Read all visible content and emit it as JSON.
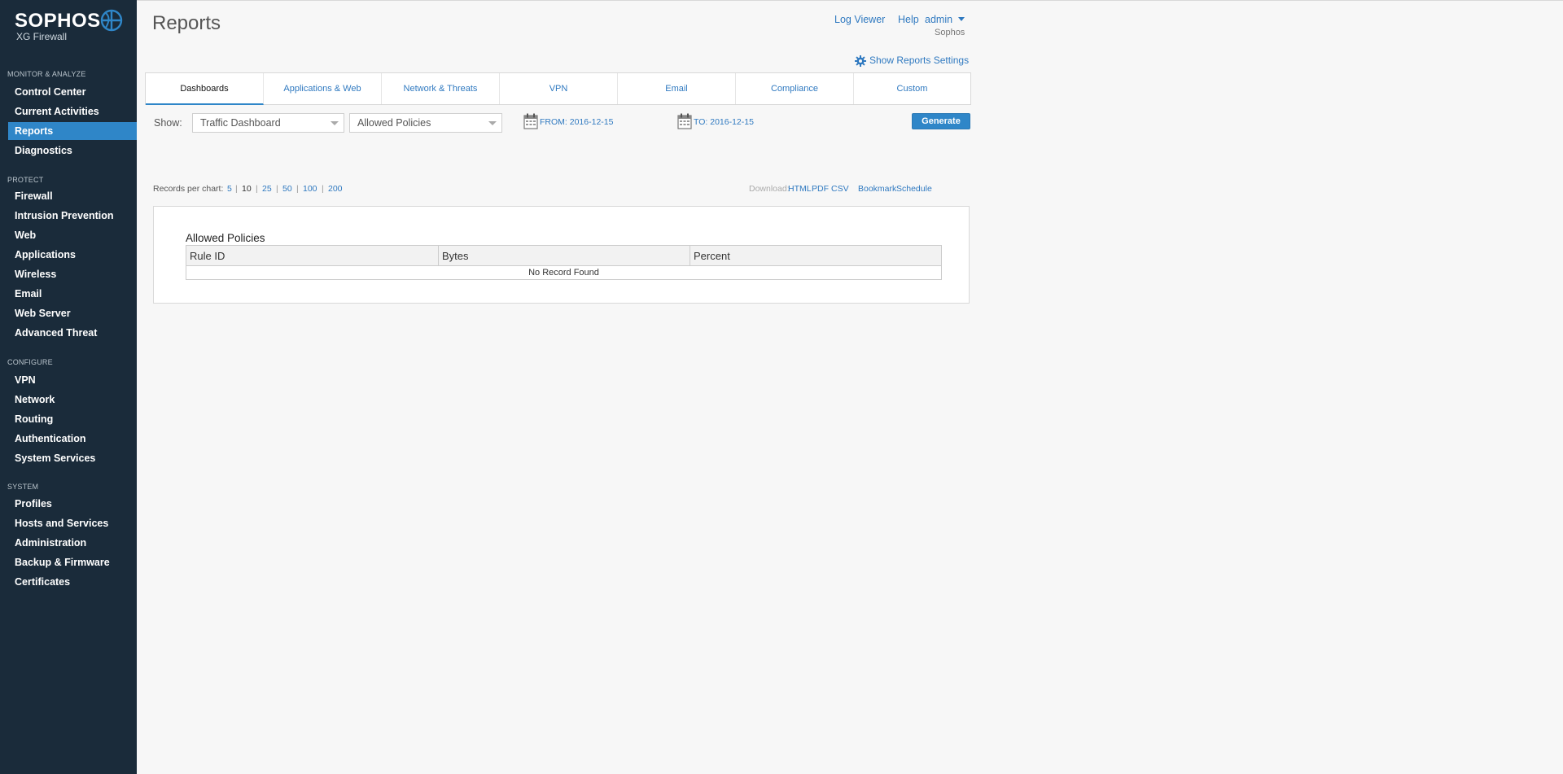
{
  "brand": {
    "name": "SOPHOS",
    "product": "XG Firewall"
  },
  "sidebar": {
    "sections": [
      {
        "title": "MONITOR & ANALYZE",
        "items": [
          "Control Center",
          "Current Activities",
          "Reports",
          "Diagnostics"
        ]
      },
      {
        "title": "PROTECT",
        "items": [
          "Firewall",
          "Intrusion Prevention",
          "Web",
          "Applications",
          "Wireless",
          "Email",
          "Web Server",
          "Advanced Threat"
        ]
      },
      {
        "title": "CONFIGURE",
        "items": [
          "VPN",
          "Network",
          "Routing",
          "Authentication",
          "System Services"
        ]
      },
      {
        "title": "SYSTEM",
        "items": [
          "Profiles",
          "Hosts and Services",
          "Administration",
          "Backup & Firmware",
          "Certificates"
        ]
      }
    ],
    "active_item": "Reports"
  },
  "header": {
    "title": "Reports",
    "links": {
      "log_viewer": "Log Viewer",
      "help": "Help",
      "user": "admin"
    },
    "org": "Sophos",
    "show_settings": "Show Reports Settings"
  },
  "tabs": [
    "Dashboards",
    "Applications & Web",
    "Network & Threats",
    "VPN",
    "Email",
    "Compliance",
    "Custom"
  ],
  "active_tab": "Dashboards",
  "filters": {
    "show_label": "Show:",
    "dashboard_select": "Traffic Dashboard",
    "report_select": "Allowed Policies",
    "from": "FROM: 2016-12-15",
    "to": "TO: 2016-12-15",
    "generate": "Generate"
  },
  "records": {
    "label": "Records per chart:",
    "options": [
      "5",
      "10",
      "25",
      "50",
      "100",
      "200"
    ],
    "current": "10"
  },
  "download": {
    "label": "Download:",
    "formats": [
      "HTML",
      "PDF",
      "CSV"
    ],
    "bookmark": "Bookmark",
    "schedule": "Schedule"
  },
  "report": {
    "title": "Allowed Policies",
    "columns": [
      "Rule ID",
      "Bytes",
      "Percent"
    ],
    "empty_message": "No Record Found"
  },
  "colors": {
    "sidebar_bg": "#1a2b3a",
    "accent": "#2f86c8",
    "link": "#2f79c0"
  }
}
